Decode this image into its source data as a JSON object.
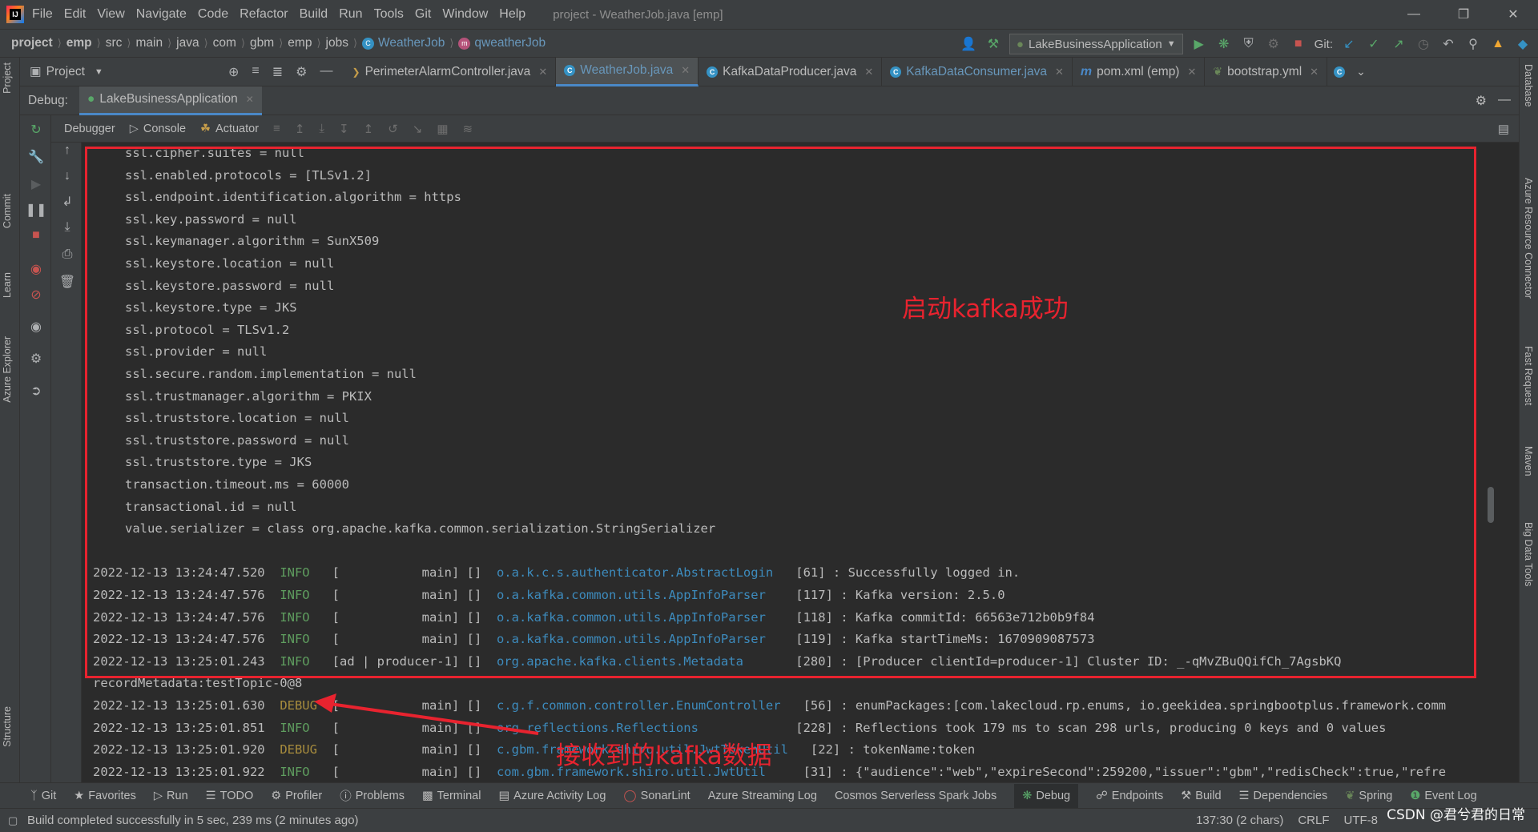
{
  "app": {
    "window_title": "project - WeatherJob.java [emp]",
    "logo_text": "IJ"
  },
  "menu": [
    "File",
    "Edit",
    "View",
    "Navigate",
    "Code",
    "Refactor",
    "Build",
    "Run",
    "Tools",
    "Git",
    "Window",
    "Help"
  ],
  "breadcrumb": {
    "items": [
      "project",
      "emp",
      "src",
      "main",
      "java",
      "com",
      "gbm",
      "emp",
      "jobs"
    ],
    "class_name": "WeatherJob",
    "method_name": "qweatherJob"
  },
  "toolbar": {
    "run_config": "LakeBusinessApplication",
    "git_label": "Git:"
  },
  "project_panel": {
    "label": "Project"
  },
  "editor_tabs": [
    {
      "label": "PerimeterAlarmController.java",
      "icon": "java-file-icon"
    },
    {
      "label": "WeatherJob.java",
      "icon": "class-icon"
    },
    {
      "label": "KafkaDataProducer.java",
      "icon": "class-icon"
    },
    {
      "label": "KafkaDataConsumer.java",
      "icon": "class-icon"
    },
    {
      "label": "pom.xml (emp)",
      "icon": "maven-icon"
    },
    {
      "label": "bootstrap.yml",
      "icon": "spring-leaf-icon"
    }
  ],
  "debug": {
    "label": "Debug:",
    "session": "LakeBusinessApplication",
    "tabs": [
      "Debugger",
      "Console",
      "Actuator"
    ]
  },
  "left_stripe": [
    "Project",
    "Commit",
    "Learn",
    "Azure Explorer",
    "Structure"
  ],
  "right_stripe": [
    "Database",
    "Azure Resource Connector",
    "Fast Request",
    "Maven",
    "Big Data Tools"
  ],
  "console": {
    "config_lines": [
      "ssl.cipher.suites = null",
      "ssl.enabled.protocols = [TLSv1.2]",
      "ssl.endpoint.identification.algorithm = https",
      "ssl.key.password = null",
      "ssl.keymanager.algorithm = SunX509",
      "ssl.keystore.location = null",
      "ssl.keystore.password = null",
      "ssl.keystore.type = JKS",
      "ssl.protocol = TLSv1.2",
      "ssl.provider = null",
      "ssl.secure.random.implementation = null",
      "ssl.trustmanager.algorithm = PKIX",
      "ssl.truststore.location = null",
      "ssl.truststore.password = null",
      "ssl.truststore.type = JKS",
      "transaction.timeout.ms = 60000",
      "transactional.id = null",
      "value.serializer = class org.apache.kafka.common.serialization.StringSerializer"
    ],
    "log_lines": [
      {
        "ts": "2022-12-13 13:24:47.520",
        "level": "INFO ",
        "thread": "[           main] []",
        "logger": "o.a.k.c.s.authenticator.AbstractLogin",
        "msg": "[61] : Successfully logged in."
      },
      {
        "ts": "2022-12-13 13:24:47.576",
        "level": "INFO ",
        "thread": "[           main] []",
        "logger": "o.a.kafka.common.utils.AppInfoParser ",
        "msg": "[117] : Kafka version: 2.5.0"
      },
      {
        "ts": "2022-12-13 13:24:47.576",
        "level": "INFO ",
        "thread": "[           main] []",
        "logger": "o.a.kafka.common.utils.AppInfoParser ",
        "msg": "[118] : Kafka commitId: 66563e712b0b9f84"
      },
      {
        "ts": "2022-12-13 13:24:47.576",
        "level": "INFO ",
        "thread": "[           main] []",
        "logger": "o.a.kafka.common.utils.AppInfoParser ",
        "msg": "[119] : Kafka startTimeMs: 1670909087573"
      },
      {
        "ts": "2022-12-13 13:25:01.243",
        "level": "INFO ",
        "thread": "[ad | producer-1] []",
        "logger": "org.apache.kafka.clients.Metadata    ",
        "msg": "[280] : [Producer clientId=producer-1] Cluster ID: _-qMvZBuQQifCh_7AgsbKQ"
      }
    ],
    "record_line": "recordMetadata:testTopic-0@8",
    "tail_lines": [
      {
        "ts": "2022-12-13 13:25:01.630",
        "level": "DEBUG",
        "thread": "[           main] []",
        "logger": "c.g.f.common.controller.EnumController",
        "msg": "[56] : enumPackages:[com.lakecloud.rp.enums, io.geekidea.springbootplus.framework.comm"
      },
      {
        "ts": "2022-12-13 13:25:01.851",
        "level": "INFO ",
        "thread": "[           main] []",
        "logger": "org.reflections.Reflections          ",
        "msg": "[228] : Reflections took 179 ms to scan 298 urls, producing 0 keys and 0 values"
      },
      {
        "ts": "2022-12-13 13:25:01.920",
        "level": "DEBUG",
        "thread": "[           main] []",
        "logger": "c.gbm.framework.shiro.util.JwtTokenUtil",
        "msg": "[22] : tokenName:token"
      },
      {
        "ts": "2022-12-13 13:25:01.922",
        "level": "INFO ",
        "thread": "[           main] []",
        "logger": "com.gbm.framework.shiro.util.JwtUtil  ",
        "msg": "[31] : {\"audience\":\"web\",\"expireSecond\":259200,\"issuer\":\"gbm\",\"redisCheck\":true,\"refre"
      }
    ]
  },
  "annotations": {
    "success": "启动kafka成功",
    "received": "接收到的kafka数据",
    "color": "#e8232f"
  },
  "bottom_tools": [
    "Git",
    "Favorites",
    "Run",
    "TODO",
    "Profiler",
    "Problems",
    "Terminal",
    "Azure Activity Log",
    "SonarLint",
    "Azure Streaming Log",
    "Cosmos Serverless Spark Jobs",
    "Debug",
    "Endpoints",
    "Build",
    "Dependencies",
    "Spring",
    "Event Log"
  ],
  "status": {
    "message": "Build completed successfully in 5 sec, 239 ms (2 minutes ago)",
    "position": "137:30 (2 chars)",
    "line_sep": "CRLF",
    "encoding": "UTF-8",
    "watermark": "CSDN @君兮君的日常"
  },
  "colors": {
    "background": "#2b2b2b",
    "panel": "#3c3f41",
    "accent": "#4a88c7",
    "info": "#5f9e5f",
    "debug": "#a68b3d",
    "logger": "#3d8bbd",
    "annotation": "#e8232f"
  }
}
